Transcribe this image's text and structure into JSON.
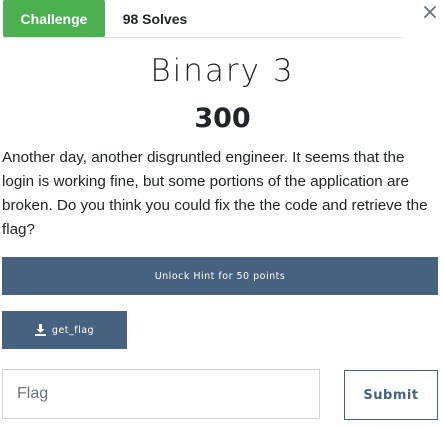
{
  "tabs": {
    "challenge_label": "Challenge",
    "solves_label": "98 Solves"
  },
  "close_glyph": "×",
  "challenge": {
    "name": "Binary 3",
    "points": "300",
    "description": "Another day, another disgruntled engineer. It seems that the login is working fine, but some portions of the application are broken. Do you think you could fix the the code and retrieve the flag?"
  },
  "hint": {
    "label": "Unlock Hint for 50 points"
  },
  "files": [
    {
      "name": "get_flag",
      "icon": "download-icon"
    }
  ],
  "form": {
    "flag_placeholder": "Flag",
    "submit_label": "Submit"
  },
  "colors": {
    "tab_active": "#4caf50",
    "button_primary": "#47627f"
  }
}
